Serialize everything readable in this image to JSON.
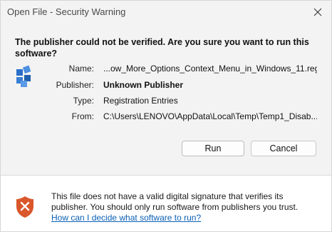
{
  "window": {
    "title": "Open File - Security Warning"
  },
  "message": {
    "headline": "The publisher could not be verified.  Are you sure you want to run this software?"
  },
  "details": [
    {
      "label": "Name:",
      "value": "...ow_More_Options_Context_Menu_in_Windows_11.reg",
      "bold": false
    },
    {
      "label": "Publisher:",
      "value": "Unknown Publisher",
      "bold": true
    },
    {
      "label": "Type:",
      "value": "Registration Entries",
      "bold": false
    },
    {
      "label": "From:",
      "value": "C:\\Users\\LENOVO\\AppData\\Local\\Temp\\Temp1_Disab...",
      "bold": false
    }
  ],
  "buttons": {
    "run": "Run",
    "cancel": "Cancel"
  },
  "footer": {
    "warning_line1": "This file does not have a valid digital signature that verifies its",
    "warning_line2": "publisher.  You should only run software from publishers you trust.",
    "link": "How can I decide what software to run?"
  },
  "colors": {
    "shield": "#d9572b",
    "link": "#0a5fb4",
    "file_icon": "#2a6fc9"
  },
  "icons": {
    "close": "close-icon",
    "file": "registry-file-icon",
    "shield": "warning-shield-icon"
  }
}
